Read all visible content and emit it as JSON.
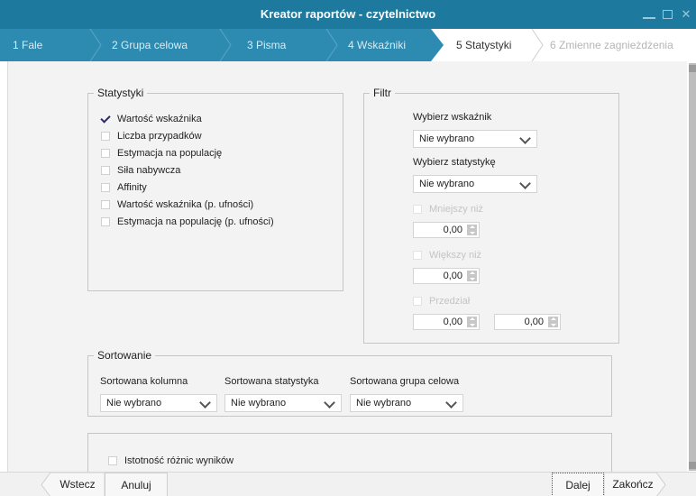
{
  "window": {
    "title": "Kreator raportów - czytelnictwo",
    "controls": [
      "minimize-icon",
      "maximize-icon",
      "close-icon"
    ]
  },
  "steps": [
    {
      "label": "1  Fale",
      "state": "done"
    },
    {
      "label": "2 Grupa celowa",
      "state": "done"
    },
    {
      "label": "3 Pisma",
      "state": "done"
    },
    {
      "label": "4 Wskaźniki",
      "state": "done"
    },
    {
      "label": "5 Statystyki",
      "state": "active"
    },
    {
      "label": "6 Zmienne zagnieżdżenia",
      "state": "disabled"
    }
  ],
  "statystyki": {
    "title": "Statystyki",
    "items": [
      {
        "label": "Wartość wskaźnika",
        "checked": true
      },
      {
        "label": "Liczba przypadków",
        "checked": false
      },
      {
        "label": "Estymacja na populację",
        "checked": false
      },
      {
        "label": "Siła nabywcza",
        "checked": false
      },
      {
        "label": "Affinity",
        "checked": false
      },
      {
        "label": "Wartość wskaźnika (p. ufności)",
        "checked": false
      },
      {
        "label": "Estymacja na populację (p. ufności)",
        "checked": false
      }
    ]
  },
  "filtr": {
    "title": "Filtr",
    "wskaznik_label": "Wybierz wskaźnik",
    "wskaznik_value": "Nie wybrano",
    "statystyka_label": "Wybierz statystykę",
    "statystyka_value": "Nie wybrano",
    "mniejszy_label": "Mniejszy niż",
    "mniejszy_value": "0,00",
    "wiekszy_label": "Większy niż",
    "wiekszy_value": "0,00",
    "przedzial_label": "Przedział",
    "przedzial_from": "0,00",
    "przedzial_to": "0,00"
  },
  "sortowanie": {
    "title": "Sortowanie",
    "kolumna_label": "Sortowana kolumna",
    "kolumna_value": "Nie wybrano",
    "statystyka_label": "Sortowana statystyka",
    "statystyka_value": "Nie wybrano",
    "grupa_label": "Sortowana grupa celowa",
    "grupa_value": "Nie wybrano"
  },
  "istotnosc": {
    "label": "Istotność różnic wyników",
    "checked": false
  },
  "bottom": {
    "back": "Wstecz",
    "cancel": "Anuluj",
    "next": "Dalej",
    "finish": "Zakończ"
  },
  "colors": {
    "titlebar": "#1d7a9e",
    "stepbar": "#2d8bb2",
    "panel": "#f3f3f3"
  }
}
